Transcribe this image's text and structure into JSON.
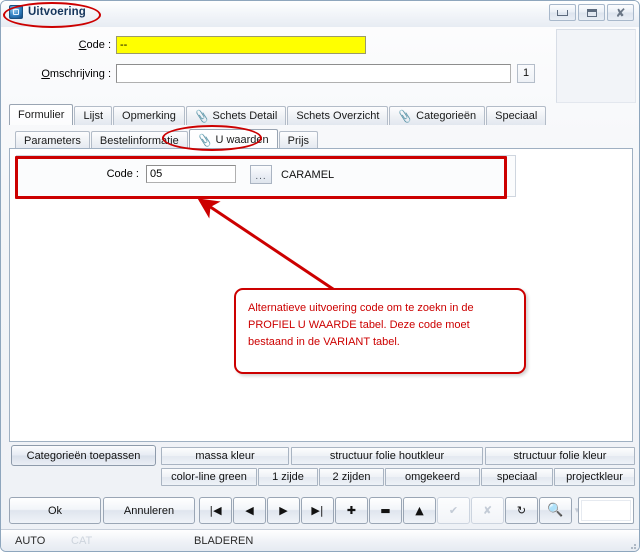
{
  "window": {
    "title": "Uitvoering",
    "icon": "window-app-icon",
    "controls": {
      "minimize": "minimize-icon",
      "maximize": "maximize-icon",
      "close": "close-icon"
    }
  },
  "header": {
    "code_label": "Code :",
    "code_value": "--",
    "code_placeholder": "",
    "omschrijving_label": "Omschrijving :",
    "omschrijving_value": "",
    "omschrijving_placeholder": "",
    "count_value": "1"
  },
  "tabs_primary": [
    {
      "label": "Formulier",
      "icon": "",
      "active": true
    },
    {
      "label": "Lijst",
      "icon": "",
      "active": false
    },
    {
      "label": "Opmerking",
      "icon": "",
      "active": false
    },
    {
      "label": "Schets Detail",
      "icon": "paperclip-icon",
      "active": false
    },
    {
      "label": "Schets Overzicht",
      "icon": "",
      "active": false
    },
    {
      "label": "Categorieën",
      "icon": "paperclip-icon",
      "active": false
    },
    {
      "label": "Speciaal",
      "icon": "",
      "active": false
    }
  ],
  "tabs_secondary": [
    {
      "label": "Parameters",
      "icon": "",
      "active": false
    },
    {
      "label": "Bestelinformatie",
      "icon": "",
      "active": false
    },
    {
      "label": "U waarden",
      "icon": "paperclip-icon",
      "active": true
    },
    {
      "label": "Prijs",
      "icon": "",
      "active": false
    }
  ],
  "form": {
    "ucode_label": "Code :",
    "ucode_value": "05",
    "ucode_placeholder": "",
    "browse_label": "...",
    "ucode_description": "CARAMEL"
  },
  "annotation": {
    "callout_text": "Alternatieve uitvoering code om te zoekn in de PROFIEL U WAARDE tabel. Deze code moet bestaand in de VARIANT tabel.",
    "color": "#cc0000"
  },
  "category_buttons_row1": [
    {
      "label": "Categorieën toepassen",
      "primary": true
    },
    {
      "label": "massa kleur",
      "primary": false
    },
    {
      "label": "structuur folie houtkleur",
      "primary": false
    },
    {
      "label": "structuur folie kleur",
      "primary": false
    }
  ],
  "category_buttons_row2": [
    {
      "label": "color-line green"
    },
    {
      "label": "1 zijde"
    },
    {
      "label": "2 zijden"
    },
    {
      "label": "omgekeerd"
    },
    {
      "label": "speciaal"
    },
    {
      "label": "projectkleur"
    }
  ],
  "toolbar": {
    "ok_label": "Ok",
    "cancel_label": "Annuleren",
    "nav": [
      {
        "name": "first-record-icon",
        "glyph": "|◀",
        "disabled": false
      },
      {
        "name": "previous-record-icon",
        "glyph": "◀",
        "disabled": false
      },
      {
        "name": "next-record-icon",
        "glyph": "▶",
        "disabled": false
      },
      {
        "name": "last-record-icon",
        "glyph": "▶|",
        "disabled": false
      },
      {
        "name": "add-record-icon",
        "glyph": "✚",
        "disabled": false
      },
      {
        "name": "delete-record-icon",
        "glyph": "▬",
        "disabled": false
      },
      {
        "name": "edit-record-icon",
        "glyph": "▲",
        "disabled": false
      },
      {
        "name": "post-edit-icon",
        "glyph": "✔",
        "disabled": true
      },
      {
        "name": "cancel-edit-icon",
        "glyph": "✘",
        "disabled": true
      },
      {
        "name": "refresh-icon",
        "glyph": "↻",
        "disabled": false
      },
      {
        "name": "find-icon",
        "glyph": "🔍",
        "disabled": false
      },
      {
        "name": "dropdown-arrow-icon",
        "glyph": "▾",
        "disabled": true
      }
    ],
    "search_value": ""
  },
  "statusbar": {
    "auto": "AUTO",
    "cat": "CAT",
    "mode": "BLADEREN"
  }
}
